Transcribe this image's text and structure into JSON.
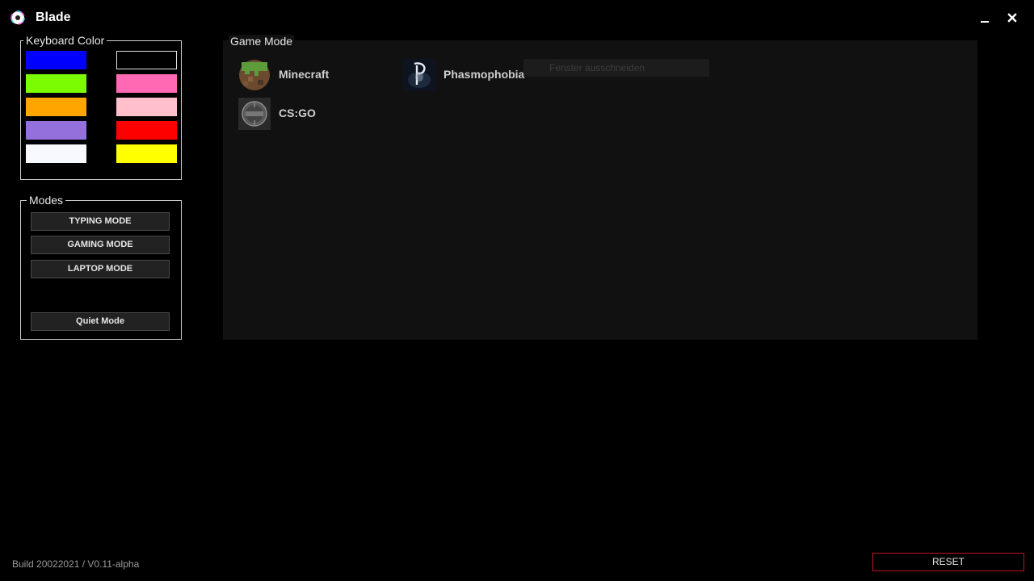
{
  "app": {
    "title": "Blade"
  },
  "keyboard_color": {
    "label": "Keyboard Color",
    "swatches": [
      {
        "color": "#0000ff"
      },
      {
        "color": "#000000"
      },
      {
        "color": "#7cfc00"
      },
      {
        "color": "#ff69b4"
      },
      {
        "color": "#ffa500"
      },
      {
        "color": "#ffc0cb"
      },
      {
        "color": "#9370db"
      },
      {
        "color": "#ff0000"
      },
      {
        "color": "#f8f8ff"
      },
      {
        "color": "#ffff00"
      }
    ]
  },
  "modes": {
    "label": "Modes",
    "buttons": [
      "TYPING MODE",
      "GAMING MODE",
      "LAPTOP MODE",
      "Quiet Mode"
    ]
  },
  "game_mode": {
    "label": "Game Mode",
    "games": [
      {
        "name": "Minecraft",
        "icon": "minecraft-icon"
      },
      {
        "name": "Phasmophobia",
        "icon": "phasmophobia-icon"
      },
      {
        "name": "CS:GO",
        "icon": "csgo-icon"
      }
    ]
  },
  "tooltip": {
    "text": "Fenster ausschneiden"
  },
  "footer": {
    "build": "Build 20022021 / V0.11-alpha",
    "reset_label": "RESET"
  },
  "colors": {
    "accent_red": "#c0151b",
    "panel_bg": "#111111"
  }
}
